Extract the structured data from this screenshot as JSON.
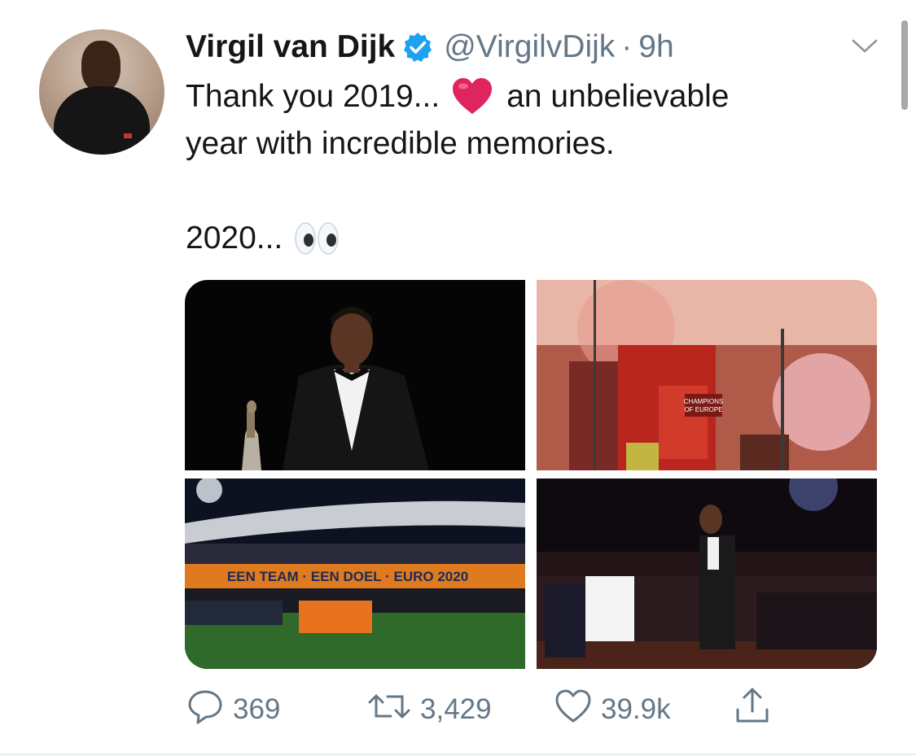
{
  "tweet": {
    "author": {
      "name": "Virgil van Dijk",
      "handle": "@VirgilvDijk",
      "separator": "·",
      "time": "9h",
      "verified": true,
      "avatar_icon": "profile-photo"
    },
    "text": {
      "line1_before": "Thank you 2019...",
      "line1_emoji": "red-heart",
      "line1_after": "an unbelievable",
      "line2": "year with incredible memories.",
      "line3": "2020...",
      "line3_emoji": "eyes"
    },
    "media": [
      {
        "icon": "player-in-tuxedo-with-trophy-photo"
      },
      {
        "icon": "champions-parade-bus-photo",
        "caption": "CHAMPIONS OF EUROPE"
      },
      {
        "icon": "stadium-banner-photo",
        "banner": "EEN TEAM · EEN DOEL · EURO 2020"
      },
      {
        "icon": "awards-ceremony-photo"
      }
    ],
    "actions": {
      "reply": {
        "icon": "reply-icon",
        "count": "369"
      },
      "retweet": {
        "icon": "retweet-icon",
        "count": "3,429"
      },
      "like": {
        "icon": "like-icon",
        "count": "39.9k"
      },
      "share": {
        "icon": "share-icon"
      }
    }
  },
  "colors": {
    "text": "#14171a",
    "secondary": "#657786",
    "verified": "#1da1f2",
    "heart": "#e0245e"
  }
}
